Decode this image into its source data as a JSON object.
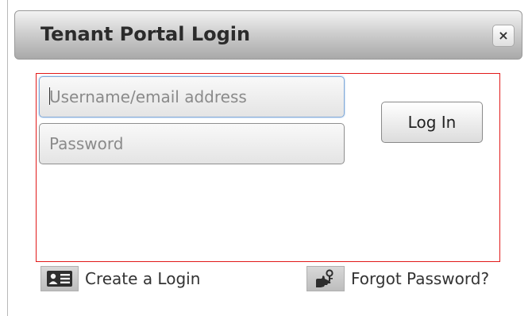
{
  "dialog": {
    "title": "Tenant Portal Login",
    "close_label": "×"
  },
  "form": {
    "username_placeholder": "Username/email address",
    "password_placeholder": "Password",
    "login_label": "Log In"
  },
  "links": {
    "create_label": "Create a Login",
    "forgot_label": "Forgot Password?"
  },
  "colors": {
    "frame_border": "#e21a1a",
    "focus_border": "#7fa8d8"
  },
  "icons": {
    "create": "id-card-icon",
    "forgot": "hand-key-icon"
  }
}
